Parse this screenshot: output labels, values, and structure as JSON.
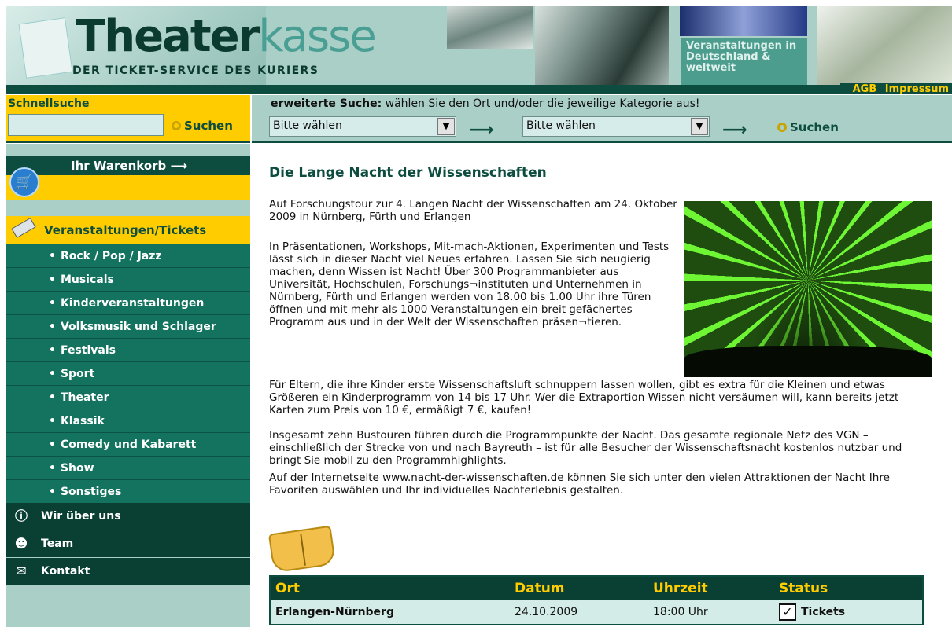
{
  "header": {
    "logo_bold": "Theater",
    "logo_light": "kasse",
    "logo_sub": "DER TICKET-SERVICE DES KURIERS",
    "veranst_line1": "Veranstaltungen in",
    "veranst_line2": "Deutschland &",
    "veranst_line3": "weltweit",
    "link_agb": "AGB",
    "link_impressum": "Impressum"
  },
  "quicksearch": {
    "label": "Schnellsuche",
    "value": "",
    "button": "Suchen"
  },
  "extsearch": {
    "label_bold": "erweiterte Suche:",
    "label_rest": " wählen Sie den Ort und/oder die jeweilige Kategorie aus!",
    "select_location": "Bitte wählen",
    "select_category": "Bitte wählen",
    "button": "Suchen"
  },
  "sidebar": {
    "cart": "Ihr Warenkorb",
    "events_header": "Veranstaltungen/Tickets",
    "categories": [
      "Rock / Pop / Jazz",
      "Musicals",
      "Kinderveranstaltungen",
      "Volksmusik und Schlager",
      "Festivals",
      "Sport",
      "Theater",
      "Klassik",
      "Comedy und Kabarett",
      "Show",
      "Sonstiges"
    ],
    "about": "Wir über uns",
    "team": "Team",
    "contact": "Kontakt"
  },
  "article": {
    "title": "Die Lange Nacht der Wissenschaften",
    "p1": "Auf Forschungstour zur 4. Langen Nacht der Wissenschaften am 24. Oktober 2009 in Nürnberg, Fürth und Erlangen",
    "p2": "In Präsentationen, Workshops, Mit-mach-Aktionen, Experimenten und Tests lässt sich in dieser Nacht viel Neues erfahren. Lassen Sie sich neugierig machen, denn Wissen ist Nacht! Über 300 Programmanbieter aus Universität, Hochschulen, Forschungs¬instituten und Unternehmen in Nürnberg, Fürth und Erlangen werden von 18.00 bis 1.00 Uhr ihre Türen öffnen und mit mehr als 1000 Veranstaltungen ein breit gefächertes Programm aus und in der Welt der Wissenschaften präsen¬tieren.",
    "p3": "Für Eltern, die ihre Kinder erste Wissenschaftsluft schnuppern lassen wollen, gibt es extra für die Kleinen und etwas Größeren ein Kinderprogramm von 14 bis 17 Uhr. Wer die Extraportion Wissen nicht versäumen will, kann bereits jetzt Karten zum Preis von 10 €, ermäßigt 7 €, kaufen!",
    "p4": "Insgesamt zehn Bustouren führen durch die Programmpunkte der Nacht. Das gesamte regionale Netz des VGN – einschließlich der Strecke von und nach Bayreuth – ist für alle Besucher der Wissenschaftsnacht kostenlos nutzbar und bringt Sie mobil zu den Programmhighlights.",
    "p5": "Auf der Internetseite www.nacht-der-wissenschaften.de können Sie sich unter den vielen Attraktionen der Nacht Ihre Favoriten auswählen und Ihr individuelles Nachterlebnis gestalten."
  },
  "table": {
    "headers": {
      "ort": "Ort",
      "datum": "Datum",
      "uhrzeit": "Uhrzeit",
      "status": "Status"
    },
    "rows": [
      {
        "ort": "Erlangen-Nürnberg",
        "datum": "24.10.2009",
        "uhrzeit": "18:00 Uhr",
        "status": "Tickets"
      }
    ]
  },
  "icons": {
    "cart": "shopping-cart-icon",
    "events": "ticket-icon",
    "about": "info-icon",
    "team": "team-icon",
    "contact": "envelope-icon",
    "search": "key-search-icon",
    "book": "book-icon",
    "check": "checkbox-icon"
  },
  "colors": {
    "dark_green": "#0d4d3f",
    "nav_green": "#13735f",
    "light_teal": "#a9cfc7",
    "yellow": "#ffcc00"
  }
}
